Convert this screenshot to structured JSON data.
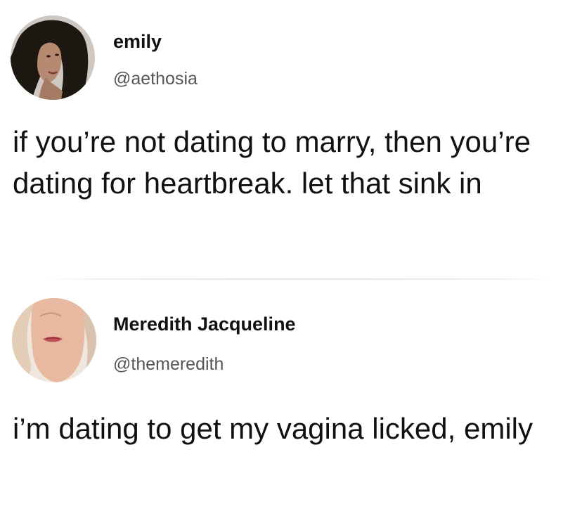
{
  "tweets": [
    {
      "name": "emily",
      "handle": "@aethosia",
      "text": "if you’re not dating to marry, then you’re dating for heartbreak. let that sink in"
    },
    {
      "name": "Meredith Jacqueline",
      "handle": "@themeredith",
      "text": "i’m dating to get my vagina licked, emily"
    }
  ],
  "colors": {
    "background": "#ffffff",
    "text": "#111111",
    "handle": "#555555"
  }
}
